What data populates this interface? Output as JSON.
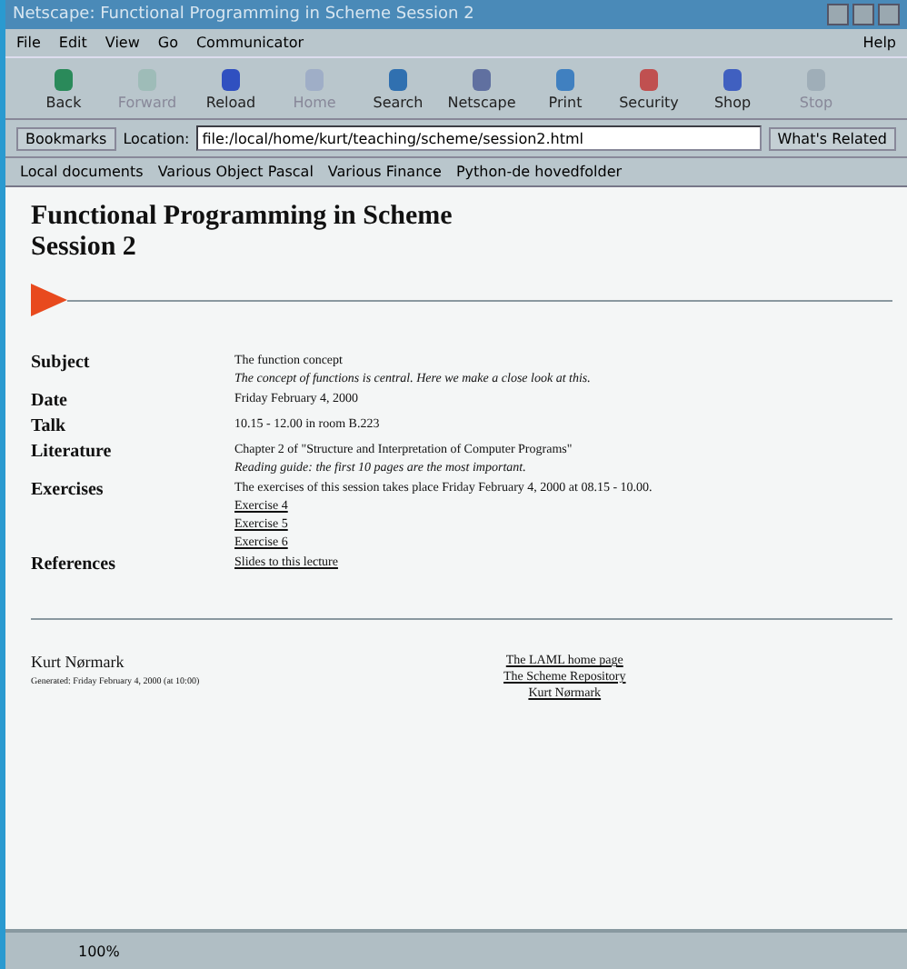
{
  "window": {
    "title": "Netscape: Functional Programming in Scheme Session 2"
  },
  "menu": [
    "File",
    "Edit",
    "View",
    "Go",
    "Communicator",
    "Help"
  ],
  "toolbar": [
    {
      "label": "Back",
      "disabled": false
    },
    {
      "label": "Forward",
      "disabled": true
    },
    {
      "label": "Reload",
      "disabled": false
    },
    {
      "label": "Home",
      "disabled": true
    },
    {
      "label": "Search",
      "disabled": false
    },
    {
      "label": "Netscape",
      "disabled": false
    },
    {
      "label": "Print",
      "disabled": false
    },
    {
      "label": "Security",
      "disabled": false
    },
    {
      "label": "Shop",
      "disabled": false
    },
    {
      "label": "Stop",
      "disabled": true
    }
  ],
  "location_bar": {
    "bookmarks": "Bookmarks",
    "location_label": "Location:",
    "url": "file:/local/home/kurt/teaching/scheme/session2.html",
    "related": "What's Related"
  },
  "personal_toolbar": [
    "Local documents",
    "Various Object Pascal",
    "Various Finance",
    "Python-de hovedfolder"
  ],
  "page": {
    "title_lines": [
      "Functional Programming in Scheme",
      "Session 2"
    ],
    "rows": [
      {
        "label": "Subject",
        "lines": [
          {
            "text": "The function concept",
            "kind": "plain"
          },
          {
            "text": "The concept of functions is central. Here we make a close look at this.",
            "kind": "italic"
          }
        ]
      },
      {
        "label": "Date",
        "lines": [
          {
            "text": "Friday February 4, 2000",
            "kind": "plain"
          }
        ]
      },
      {
        "label": "Talk",
        "lines": [
          {
            "text": "10.15 - 12.00 in room B.223",
            "kind": "plain"
          }
        ]
      },
      {
        "label": "Literature",
        "lines": [
          {
            "text": "Chapter 2 of \"Structure and Interpretation of Computer Programs\"",
            "kind": "plain"
          },
          {
            "text": "Reading guide: the first 10 pages are the most important.",
            "kind": "italic"
          }
        ]
      },
      {
        "label": "Exercises",
        "lines": [
          {
            "text": "The exercises of this session takes place Friday February 4, 2000 at 08.15 - 10.00.",
            "kind": "plain"
          },
          {
            "text": "Exercise 4",
            "kind": "link"
          },
          {
            "text": "Exercise 5",
            "kind": "link"
          },
          {
            "text": "Exercise 6",
            "kind": "link"
          }
        ]
      },
      {
        "label": "References",
        "lines": [
          {
            "text": "Slides to this lecture",
            "kind": "link"
          }
        ]
      }
    ],
    "author": "Kurt Nørmark",
    "generated": "Generated: Friday February 4, 2000 (at 10:00)",
    "footer_links": [
      "The LAML home page",
      "The Scheme Repository",
      "Kurt Nørmark"
    ]
  },
  "status_bar": {
    "progress": "100%"
  }
}
